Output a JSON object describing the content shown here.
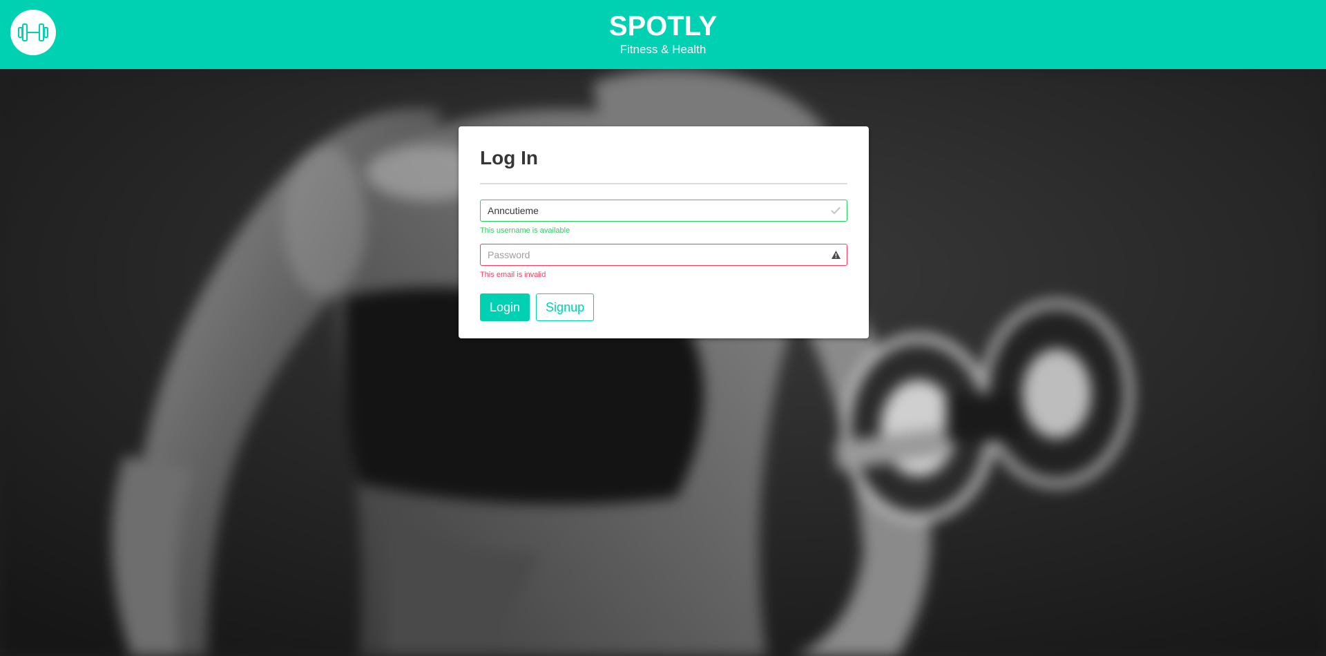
{
  "header": {
    "logo_icon": "dumbbell-icon",
    "title": "SPOTLY",
    "subtitle": "Fitness & Health",
    "background_color": "#00d1b2"
  },
  "hero": {
    "background_image": "blurred-grayscale-photo-of-woman-lifting-dumbbell"
  },
  "login_form": {
    "title": "Log In",
    "username": {
      "value": "Anncutieme",
      "status_icon": "check-icon",
      "help_text": "This username is available",
      "status_color": "#23d160"
    },
    "password": {
      "value": "",
      "placeholder": "Password",
      "status_icon": "warning-triangle-icon",
      "help_text": "This email is invalid",
      "status_color": "#ff3860"
    },
    "login_label": "Login",
    "signup_label": "Signup",
    "accent_color": "#00d1b2"
  }
}
